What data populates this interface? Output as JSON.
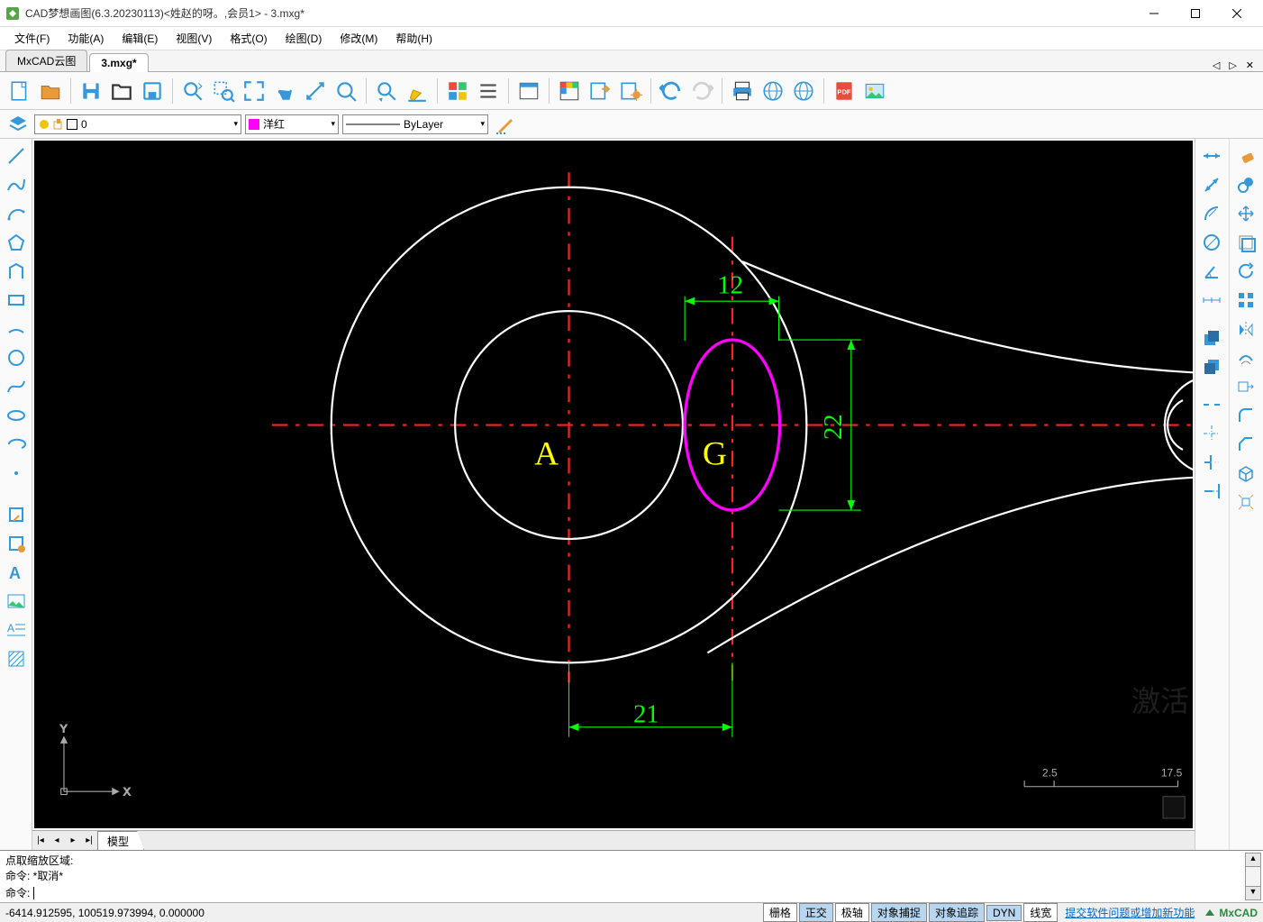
{
  "window": {
    "title": "CAD梦想画图(6.3.20230113)<姓赵的呀。,会员1> - 3.mxg*"
  },
  "menu": {
    "file": "文件(F)",
    "func": "功能(A)",
    "edit": "编辑(E)",
    "view": "视图(V)",
    "format": "格式(O)",
    "draw": "绘图(D)",
    "modify": "修改(M)",
    "help": "帮助(H)"
  },
  "tabs": {
    "cloud": "MxCAD云图",
    "file": "3.mxg*"
  },
  "layer": {
    "current": "0",
    "color": "洋红",
    "linetype": "ByLayer"
  },
  "model_tab": "模型",
  "command": {
    "hist1": "点取缩放区域:",
    "hist2": "命令:   *取消*",
    "prompt": "命令:",
    "input": ""
  },
  "status": {
    "coords": "-6414.912595,  100519.973994,  0.000000",
    "grid": "栅格",
    "ortho": "正交",
    "polar": "极轴",
    "osnap": "对象捕捉",
    "otrack": "对象追踪",
    "dyn": "DYN",
    "lwt": "线宽",
    "feedback": "提交软件问题或增加新功能",
    "brand": "MxCAD"
  },
  "drawing": {
    "label_A": "A",
    "label_G": "G",
    "dim_h_bottom": "21",
    "dim_h_top": "12",
    "dim_v_right": "22",
    "scale_left": "2.5",
    "scale_right": "17.5",
    "axis_x": "X",
    "axis_y": "Y"
  },
  "watermark": "激活"
}
